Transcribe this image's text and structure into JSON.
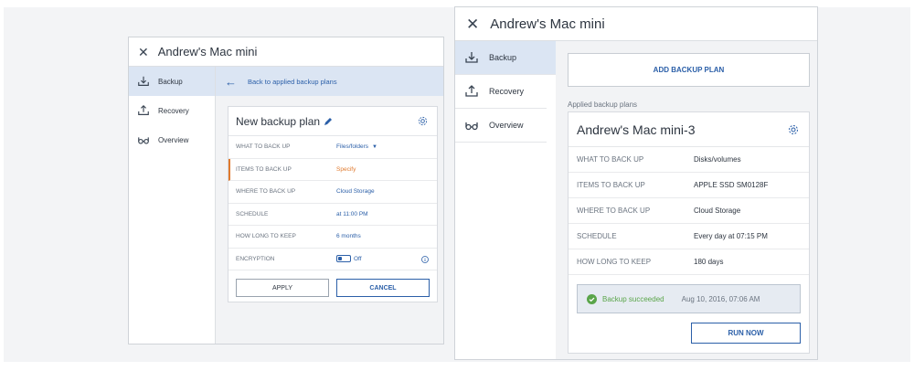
{
  "colors": {
    "accent": "#2b5fa8",
    "warning": "#e07a2e",
    "success": "#5aa54a",
    "active_nav_bg": "#dbe5f3"
  },
  "left_panel": {
    "title": "Andrew's Mac mini",
    "nav": [
      {
        "label": "Backup",
        "icon": "backup-icon",
        "active": true
      },
      {
        "label": "Recovery",
        "icon": "recovery-icon",
        "active": false
      },
      {
        "label": "Overview",
        "icon": "glasses-icon",
        "active": false
      }
    ],
    "back_link": "Back to applied backup plans",
    "plan": {
      "title": "New backup plan",
      "rows": [
        {
          "label": "WHAT TO BACK UP",
          "value": "Files/folders"
        },
        {
          "label": "ITEMS TO BACK UP",
          "value": "Specify"
        },
        {
          "label": "WHERE TO BACK UP",
          "value": "Cloud Storage"
        },
        {
          "label": "SCHEDULE",
          "value": "at 11:00 PM"
        },
        {
          "label": "HOW LONG TO KEEP",
          "value": "6 months"
        },
        {
          "label": "ENCRYPTION",
          "value": "Off"
        }
      ],
      "apply_label": "APPLY",
      "cancel_label": "CANCEL"
    }
  },
  "right_panel": {
    "title": "Andrew's Mac mini",
    "nav": [
      {
        "label": "Backup",
        "icon": "backup-icon",
        "active": true
      },
      {
        "label": "Recovery",
        "icon": "recovery-icon",
        "active": false
      },
      {
        "label": "Overview",
        "icon": "glasses-icon",
        "active": false
      }
    ],
    "add_plan_label": "ADD BACKUP PLAN",
    "applied_label": "Applied backup plans",
    "plan": {
      "title": "Andrew's Mac mini-3",
      "rows": [
        {
          "label": "WHAT TO BACK UP",
          "value": "Disks/volumes"
        },
        {
          "label": "ITEMS TO BACK UP",
          "value": "APPLE SSD SM0128F"
        },
        {
          "label": "WHERE TO BACK UP",
          "value": "Cloud Storage"
        },
        {
          "label": "SCHEDULE",
          "value": "Every day at 07:15 PM"
        },
        {
          "label": "HOW LONG TO KEEP",
          "value": "180 days"
        }
      ],
      "status_text": "Backup succeeded",
      "status_time": "Aug 10, 2016, 07:06 AM",
      "run_now_label": "RUN NOW"
    }
  }
}
